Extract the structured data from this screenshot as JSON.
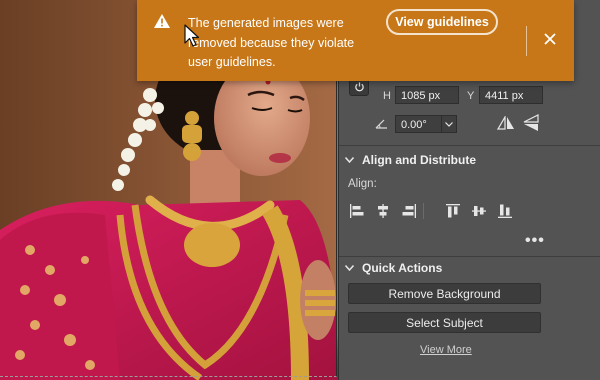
{
  "toast": {
    "message": "The generated images were removed because they violate user guidelines.",
    "button_label": "View guidelines",
    "color": "#c77718"
  },
  "properties": {
    "h_label": "H",
    "h_value": "1085 px",
    "y_label": "Y",
    "y_value": "4411 px",
    "angle_value": "0.00°"
  },
  "align_section": {
    "title": "Align and Distribute",
    "align_label": "Align:",
    "icons": [
      "align-left-icon",
      "align-center-horizontal-icon",
      "align-right-icon",
      "align-top-icon",
      "align-center-vertical-icon",
      "align-bottom-icon"
    ]
  },
  "quick_actions": {
    "title": "Quick Actions",
    "remove_bg": "Remove Background",
    "select_subject": "Select Subject",
    "view_more": "View More"
  }
}
